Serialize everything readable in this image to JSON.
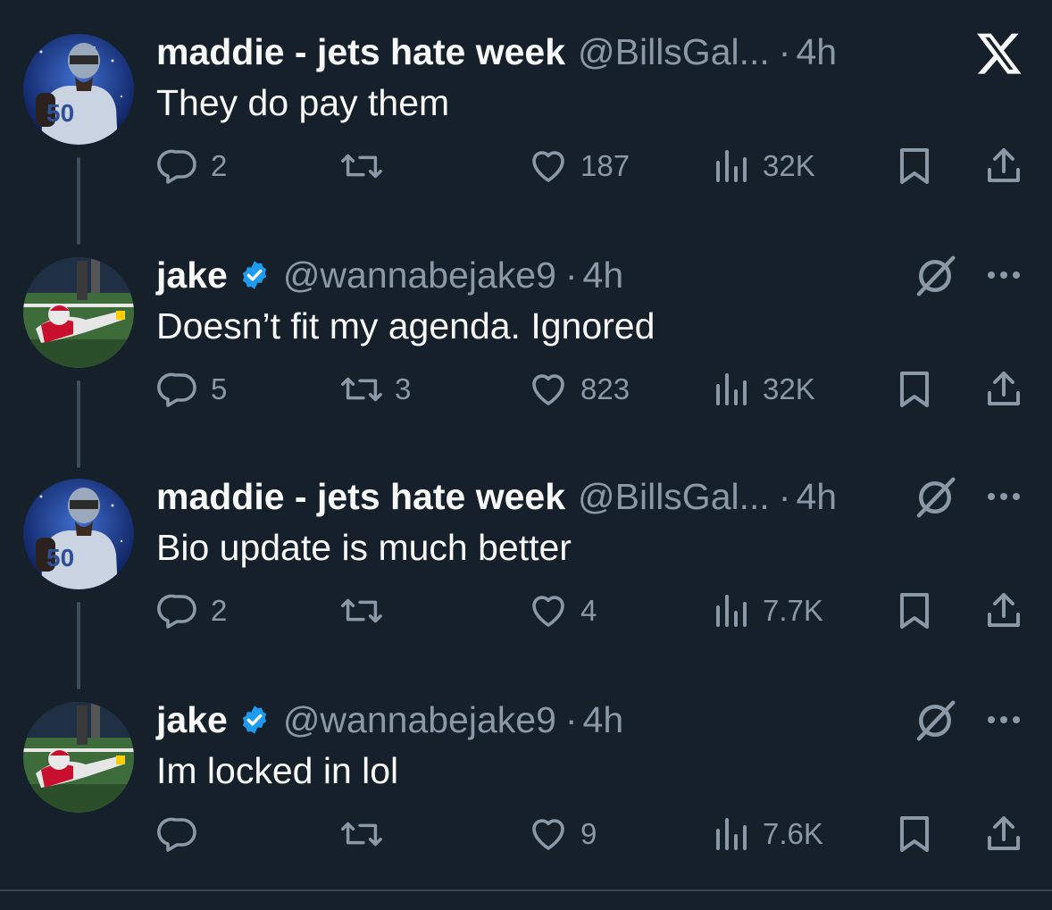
{
  "colors": {
    "background": "#15202b",
    "text_primary": "#f7f9f9",
    "text_secondary": "#8b98a5",
    "verified_blue": "#1d9bf0",
    "thread_line": "#3f4d5a"
  },
  "tweets": [
    {
      "name": "maddie - jets hate week",
      "handle": "@BillsGal...",
      "dot": "·",
      "time": "4h",
      "verified": false,
      "text": "They do pay them",
      "reply_count": "2",
      "retweet_count": "",
      "like_count": "187",
      "view_count": "32K",
      "top_icon": "x-logo"
    },
    {
      "name": "jake",
      "handle": "@wannabejake9",
      "dot": "·",
      "time": "4h",
      "verified": true,
      "text": "Doesn’t fit my agenda. Ignored",
      "reply_count": "5",
      "retweet_count": "3",
      "like_count": "823",
      "view_count": "32K",
      "top_icon": "grok-and-more"
    },
    {
      "name": "maddie - jets hate week",
      "handle": "@BillsGal...",
      "dot": "·",
      "time": "4h",
      "verified": false,
      "text": "Bio update is much better",
      "reply_count": "2",
      "retweet_count": "",
      "like_count": "4",
      "view_count": "7.7K",
      "top_icon": "grok-and-more"
    },
    {
      "name": "jake",
      "handle": "@wannabejake9",
      "dot": "·",
      "time": "4h",
      "verified": true,
      "text": "Im locked in lol",
      "reply_count": "",
      "retweet_count": "",
      "like_count": "9",
      "view_count": "7.6K",
      "top_icon": "grok-and-more"
    }
  ]
}
